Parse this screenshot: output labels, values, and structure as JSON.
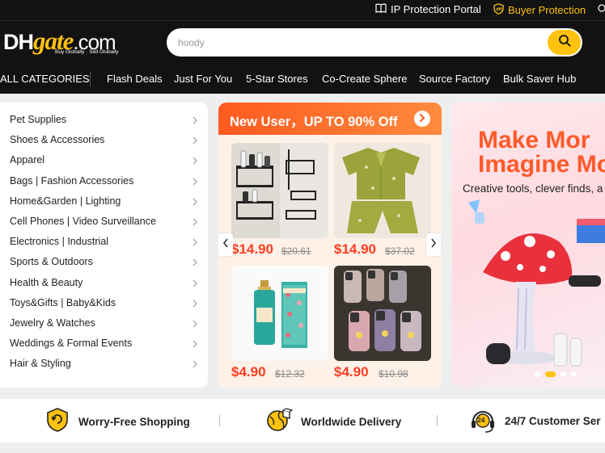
{
  "topbar": {
    "ip_protection": "IP Protection Portal",
    "buyer_protection": "Buyer Protection"
  },
  "logo": {
    "part1": "DH",
    "part2": "gate",
    "part3": ".com",
    "tagline": "Buy Globally · Sell Globally"
  },
  "search": {
    "placeholder": "hoody"
  },
  "nav": {
    "all_categories": "ALL CATEGORIES",
    "items": [
      "Flash Deals",
      "Just For You",
      "5-Star Stores",
      "Co-Create Sphere",
      "Source Factory",
      "Bulk Saver Hub"
    ]
  },
  "categories": [
    "Pet Supplies",
    "Shoes & Accessories",
    "Apparel",
    "Bags  |  Fashion Accessories",
    "Home&Garden  |  Lighting",
    "Cell Phones  |  Video Surveillance",
    "Electronics  |  Industrial",
    "Sports & Outdoors",
    "Health & Beauty",
    "Toys&Gifts  |  Baby&Kids",
    "Jewelry & Watches",
    "Weddings & Formal Events",
    "Hair & Styling"
  ],
  "deal": {
    "title": "New User，UP TO 90% Off",
    "products": [
      {
        "price": "$14.90",
        "old_price": "$20.61"
      },
      {
        "price": "$14.90",
        "old_price": "$37.02"
      },
      {
        "price": "$4.90",
        "old_price": "$12.32"
      },
      {
        "price": "$4.90",
        "old_price": "$10.98"
      }
    ]
  },
  "banner": {
    "line1": "Make Mor",
    "line2": "Imagine Mo",
    "subtitle": "Creative tools, clever finds, a"
  },
  "services": {
    "worry_free": "Worry-Free Shopping",
    "worldwide": "Worldwide Delivery",
    "support": "24/7 Customer Ser",
    "support_badge": "24"
  },
  "colors": {
    "brand_yellow": "#ffc20e",
    "header_bg": "#121212",
    "price_red": "#ff3d1f",
    "deal_orange": "#ff5a1f",
    "banner_text": "#ff5a2a"
  }
}
